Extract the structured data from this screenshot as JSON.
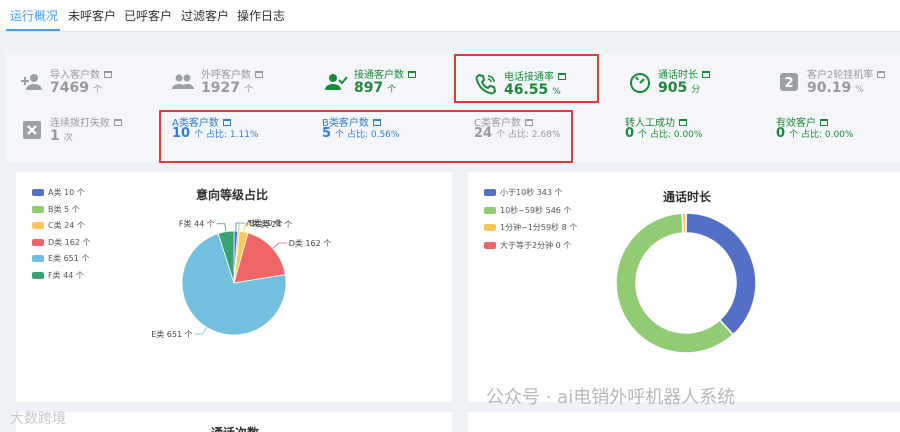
{
  "tabs": [
    {
      "label": "运行概况",
      "active": true
    },
    {
      "label": "未呼客户"
    },
    {
      "label": "已呼客户"
    },
    {
      "label": "过滤客户"
    },
    {
      "label": "操作日志"
    }
  ],
  "stats": {
    "imported": {
      "label": "导入客户数",
      "value": "7469",
      "unit": "个"
    },
    "outbound": {
      "label": "外呼客户数",
      "value": "1927",
      "unit": "个"
    },
    "connected": {
      "label": "接通客户数",
      "value": "897",
      "unit": "个"
    },
    "connect_rate": {
      "label": "电话接通率",
      "value": "46.55",
      "unit": "%"
    },
    "call_duration": {
      "label": "通话时长",
      "value": "905",
      "unit": "分"
    },
    "second_round": {
      "label": "客户2轮挂机率",
      "value": "90.19",
      "unit": "%"
    },
    "redial_fail": {
      "label": "连续拨打失败",
      "value": "1",
      "unit": "次"
    },
    "class_a": {
      "label": "A类客户数",
      "value": "10",
      "unit": "个",
      "ratio_label": "占比:",
      "ratio": "1.11%"
    },
    "class_b": {
      "label": "B类客户数",
      "value": "5",
      "unit": "个",
      "ratio_label": "占比:",
      "ratio": "0.56%"
    },
    "class_c": {
      "label": "C类客户数",
      "value": "24",
      "unit": "个",
      "ratio_label": "占比:",
      "ratio": "2.68%"
    },
    "transfer": {
      "label": "转人工成功",
      "value": "0",
      "unit": "个",
      "ratio_label": "占比:",
      "ratio": "0.00%"
    },
    "valid": {
      "label": "有效客户",
      "value": "0",
      "unit": "个",
      "ratio_label": "占比:",
      "ratio": "0.00%"
    }
  },
  "chart_data": [
    {
      "type": "pie",
      "title": "意向等级占比",
      "categories": [
        "A类",
        "B类",
        "C类",
        "D类",
        "E类",
        "F类"
      ],
      "values": [
        10,
        5,
        24,
        162,
        651,
        44
      ],
      "unit": "个",
      "colors": [
        "#5470c6",
        "#91cc75",
        "#fac858",
        "#ee6666",
        "#73c0de",
        "#3ba272"
      ],
      "legend": [
        "A类 10 个",
        "B类 5 个",
        "C类 24 个",
        "D类 162 个",
        "E类 651 个",
        "F类 44 个"
      ],
      "labels": [
        "A类 10 个",
        "B类 5 个",
        "C类 24 个",
        "D类 162 个",
        "E类 651 个",
        "F类 44 个"
      ],
      "legend_position": "top-left"
    },
    {
      "type": "pie",
      "variant": "donut",
      "title": "通话时长",
      "categories": [
        "小于10秒",
        "10秒~59秒",
        "1分钟~1分59秒",
        "大于等于2分钟"
      ],
      "values": [
        343,
        546,
        8,
        0
      ],
      "colors": [
        "#5470c6",
        "#91cc75",
        "#fac858",
        "#ee6666"
      ],
      "legend": [
        "小于10秒 343 个",
        "10秒~59秒 546 个",
        "1分钟~1分59秒 8 个",
        "大于等于2分钟 0 个"
      ],
      "legend_position": "top-left"
    }
  ],
  "bottom_card": {
    "title": "通话次数"
  },
  "watermark": {
    "text": "公众号 · ai电销外呼机器人系统",
    "corner": "大数跨境"
  }
}
